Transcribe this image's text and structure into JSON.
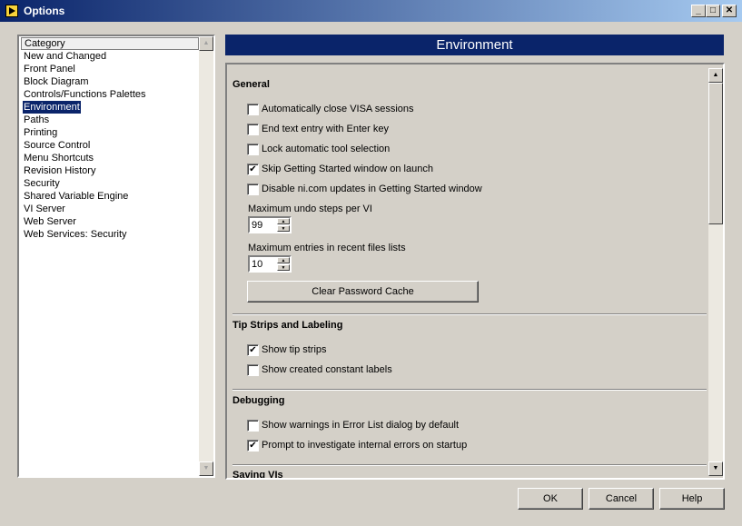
{
  "window": {
    "title": "Options",
    "controls": {
      "minimize": "_",
      "maximize": "□",
      "close": "✕"
    }
  },
  "sidebar": {
    "header": "Category",
    "items": [
      "New and Changed",
      "Front Panel",
      "Block Diagram",
      "Controls/Functions Palettes",
      "Environment",
      "Paths",
      "Printing",
      "Source Control",
      "Menu Shortcuts",
      "Revision History",
      "Security",
      "Shared Variable Engine",
      "VI Server",
      "Web Server",
      "Web Services: Security"
    ],
    "selected_index": 4
  },
  "main": {
    "header": "Environment",
    "general": {
      "title": "General",
      "options": [
        {
          "label": "Automatically close VISA sessions",
          "checked": false
        },
        {
          "label": "End text entry with Enter key",
          "checked": false
        },
        {
          "label": "Lock automatic tool selection",
          "checked": false
        },
        {
          "label": "Skip Getting Started window on launch",
          "checked": true
        },
        {
          "label": "Disable ni.com updates in Getting Started window",
          "checked": false
        }
      ],
      "undo_label": "Maximum undo steps per VI",
      "undo_value": "99",
      "recent_label": "Maximum entries in recent files lists",
      "recent_value": "10",
      "clear_password_label": "Clear Password Cache"
    },
    "tips": {
      "title": "Tip Strips and Labeling",
      "options": [
        {
          "label": "Show tip strips",
          "checked": true
        },
        {
          "label": "Show created constant labels",
          "checked": false
        }
      ]
    },
    "debugging": {
      "title": "Debugging",
      "options": [
        {
          "label": "Show warnings in Error List dialog by default",
          "checked": false
        },
        {
          "label": "Prompt to investigate internal errors on startup",
          "checked": true
        }
      ]
    },
    "saving": {
      "title": "Saving VIs"
    }
  },
  "footer": {
    "ok": "OK",
    "cancel": "Cancel",
    "help": "Help"
  },
  "glyphs": {
    "check": "✔",
    "arrow_up": "▲",
    "arrow_down": "▼"
  }
}
